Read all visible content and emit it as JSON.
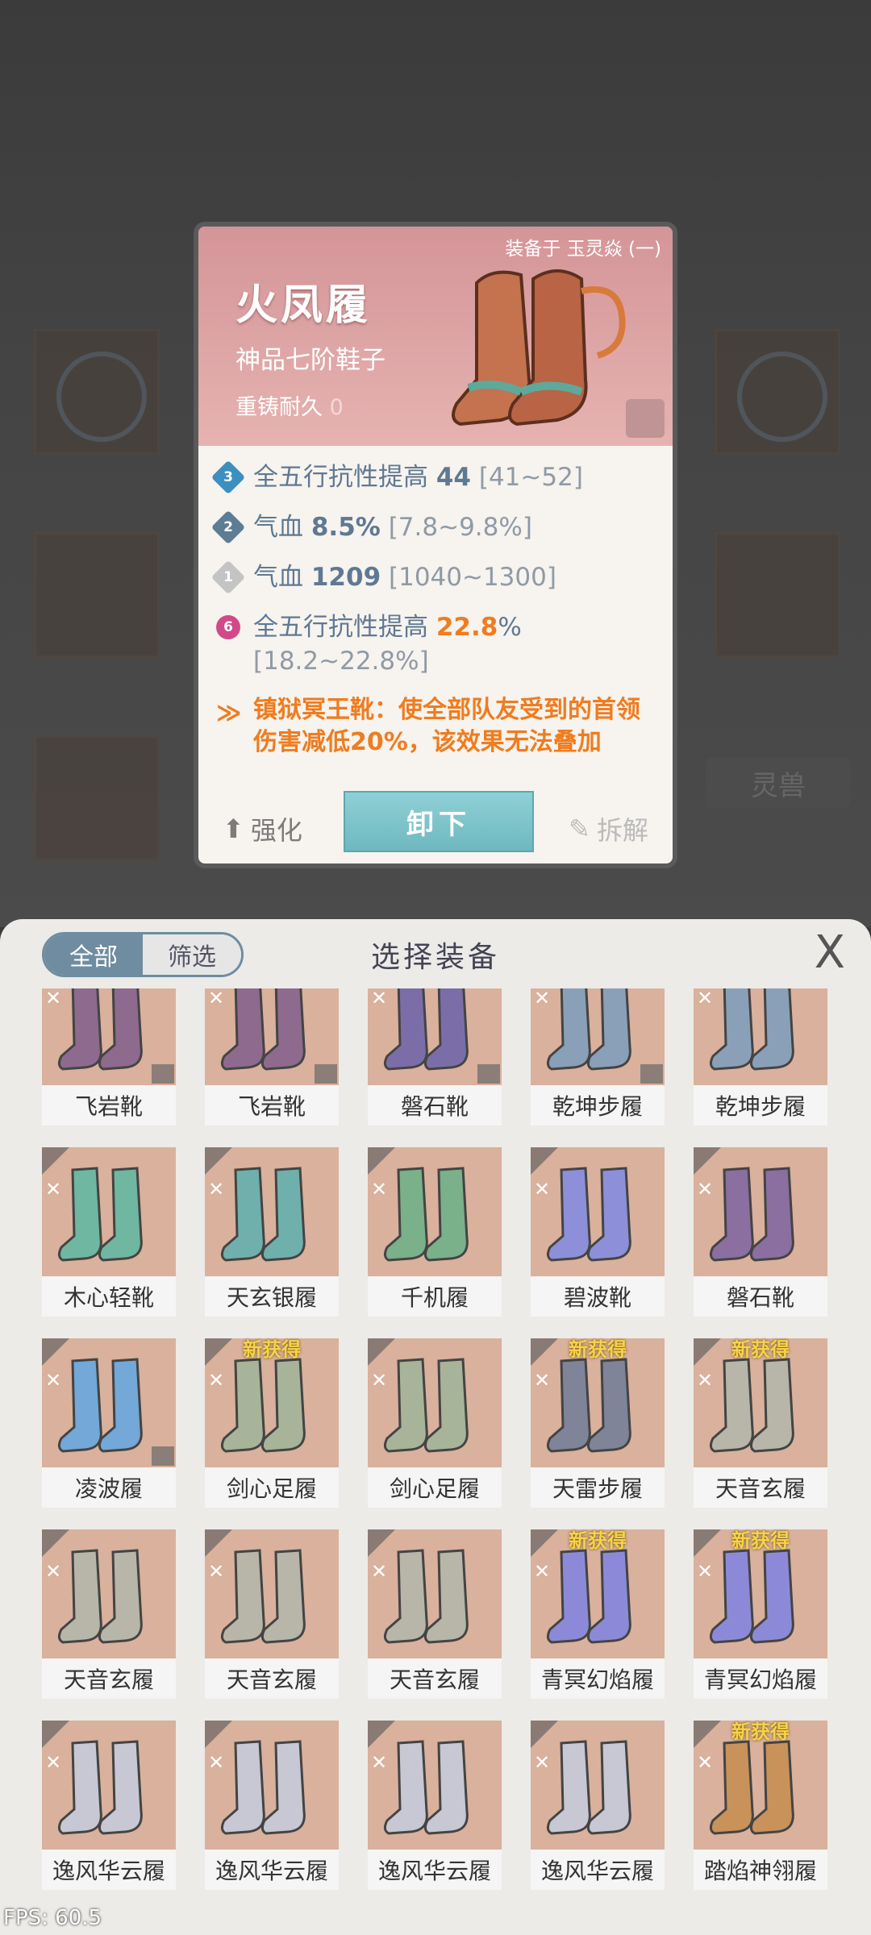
{
  "background": {
    "side_tag": "灵兽"
  },
  "detail": {
    "equipped_on": "装备于 玉灵焱 (一)",
    "name": "火凤履",
    "grade": "神品七阶鞋子",
    "reforge_label": "重铸耐久",
    "reforge_value": "0",
    "stats": [
      {
        "badge": "3",
        "color": "#3d8fbf",
        "label": "全五行抗性提高",
        "value": "44",
        "range": "[41~52]",
        "highlight": false
      },
      {
        "badge": "2",
        "color": "#5c7d93",
        "label": "气血",
        "value": "8.5%",
        "range": "[7.8~9.8%]",
        "highlight": false
      },
      {
        "badge": "1",
        "color": "#c4c4c4",
        "label": "气血",
        "value": "1209",
        "range": "[1040~1300]",
        "highlight": false
      },
      {
        "badge": "6",
        "color": "#d04a8a",
        "label": "全五行抗性提高",
        "value": "22.8",
        "unit": "%",
        "range": "[18.2~22.8%]",
        "highlight": true
      }
    ],
    "special_effect": "镇狱冥王靴：使全部队友受到的首领伤害减低20%，该效果无法叠加",
    "buttons": {
      "strengthen": "强化",
      "unequip": "卸下",
      "dismantle": "拆解"
    }
  },
  "panel": {
    "title": "选择装备",
    "tabs": [
      {
        "label": "全部",
        "active": true
      },
      {
        "label": "筛选",
        "active": false
      }
    ],
    "close_label": "X",
    "new_label": "新获得",
    "items": [
      {
        "name": "飞岩靴",
        "new": false,
        "lock": true,
        "tint": "#8e6a8e"
      },
      {
        "name": "飞岩靴",
        "new": false,
        "lock": true,
        "tint": "#8e6a8e"
      },
      {
        "name": "磐石靴",
        "new": false,
        "lock": true,
        "tint": "#7b6ea8"
      },
      {
        "name": "乾坤步履",
        "new": false,
        "lock": true,
        "tint": "#8aa0b8"
      },
      {
        "name": "乾坤步履",
        "new": false,
        "lock": false,
        "tint": "#8aa0b8"
      },
      {
        "name": "木心轻靴",
        "new": false,
        "lock": false,
        "tint": "#6fb7a0"
      },
      {
        "name": "天玄银履",
        "new": false,
        "lock": false,
        "tint": "#6fb0ad"
      },
      {
        "name": "千机履",
        "new": false,
        "lock": false,
        "tint": "#7ab08a"
      },
      {
        "name": "碧波靴",
        "new": false,
        "lock": false,
        "tint": "#8d8fd8"
      },
      {
        "name": "磐石靴",
        "new": false,
        "lock": false,
        "tint": "#8a6fa0"
      },
      {
        "name": "凌波履",
        "new": false,
        "lock": true,
        "tint": "#73a8d8"
      },
      {
        "name": "剑心足履",
        "new": true,
        "lock": false,
        "tint": "#a8b49a"
      },
      {
        "name": "剑心足履",
        "new": false,
        "lock": false,
        "tint": "#a8b49a"
      },
      {
        "name": "天雷步履",
        "new": true,
        "lock": false,
        "tint": "#7f8499"
      },
      {
        "name": "天音玄履",
        "new": true,
        "lock": false,
        "tint": "#b8b6a8"
      },
      {
        "name": "天音玄履",
        "new": false,
        "lock": false,
        "tint": "#b8b6a8"
      },
      {
        "name": "天音玄履",
        "new": false,
        "lock": false,
        "tint": "#b8b6a8"
      },
      {
        "name": "天音玄履",
        "new": false,
        "lock": false,
        "tint": "#b8b6a8"
      },
      {
        "name": "青冥幻焰履",
        "new": true,
        "lock": false,
        "tint": "#8c8ad8"
      },
      {
        "name": "青冥幻焰履",
        "new": true,
        "lock": false,
        "tint": "#8c8ad8"
      },
      {
        "name": "逸风华云履",
        "new": false,
        "lock": false,
        "tint": "#c8c8d4"
      },
      {
        "name": "逸风华云履",
        "new": false,
        "lock": false,
        "tint": "#c8c8d4"
      },
      {
        "name": "逸风华云履",
        "new": false,
        "lock": false,
        "tint": "#c8c8d4"
      },
      {
        "name": "逸风华云履",
        "new": false,
        "lock": false,
        "tint": "#c8c8d4"
      },
      {
        "name": "踏焰神翎履",
        "new": true,
        "lock": false,
        "tint": "#c8925a"
      }
    ]
  },
  "fps": "FPS: 60.5"
}
